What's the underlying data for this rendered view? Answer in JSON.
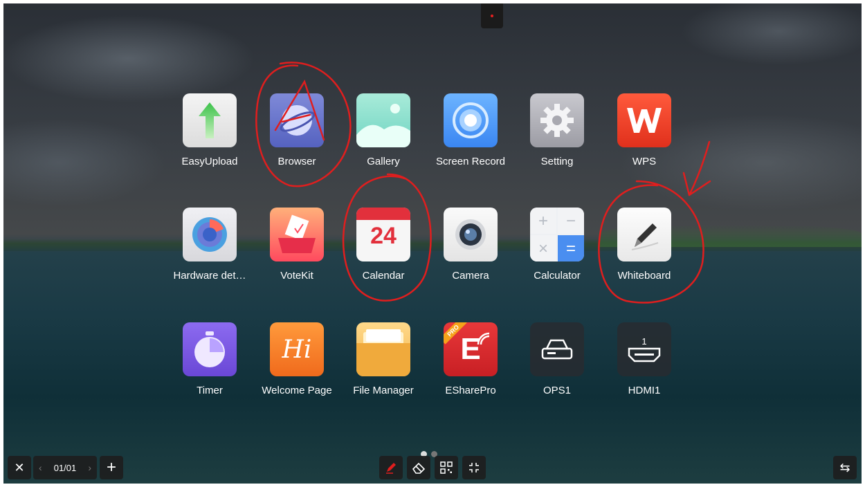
{
  "apps": [
    {
      "id": "easyupload",
      "label": "EasyUpload",
      "icon": "upload-arrow-icon"
    },
    {
      "id": "browser",
      "label": "Browser",
      "icon": "browser-planet-icon"
    },
    {
      "id": "gallery",
      "label": "Gallery",
      "icon": "landscape-icon"
    },
    {
      "id": "screen-record",
      "label": "Screen Record",
      "icon": "record-circle-icon"
    },
    {
      "id": "setting",
      "label": "Setting",
      "icon": "gear-icon"
    },
    {
      "id": "wps",
      "label": "WPS",
      "icon": "wps-logo-icon"
    },
    {
      "id": "hardware",
      "label": "Hardware det…",
      "icon": "radar-icon"
    },
    {
      "id": "votekit",
      "label": "VoteKit",
      "icon": "ballot-box-icon"
    },
    {
      "id": "calendar",
      "label": "Calendar",
      "icon": "calendar-icon",
      "day": "24"
    },
    {
      "id": "camera",
      "label": "Camera",
      "icon": "camera-lens-icon"
    },
    {
      "id": "calculator",
      "label": "Calculator",
      "icon": "calculator-icon",
      "keys": [
        "+",
        "−",
        "×",
        "="
      ]
    },
    {
      "id": "whiteboard",
      "label": "Whiteboard",
      "icon": "pen-icon"
    },
    {
      "id": "timer",
      "label": "Timer",
      "icon": "stopwatch-icon"
    },
    {
      "id": "welcome",
      "label": "Welcome Page",
      "icon": "hi-icon",
      "glyph": "Hi"
    },
    {
      "id": "file-manager",
      "label": "File Manager",
      "icon": "folder-icon"
    },
    {
      "id": "esharepro",
      "label": "ESharePro",
      "icon": "eshare-icon",
      "glyph": "E",
      "badge": "PRO"
    },
    {
      "id": "ops1",
      "label": "OPS1",
      "icon": "ops-device-icon"
    },
    {
      "id": "hdmi1",
      "label": "HDMI1",
      "icon": "hdmi-port-icon",
      "port_number": "1"
    }
  ],
  "bottom_bar": {
    "close_glyph": "✕",
    "page_indicator": "01/01",
    "prev_glyph": "‹",
    "next_glyph": "›",
    "add_glyph": "+",
    "tools": [
      "pen-icon",
      "eraser-icon",
      "qr-code-icon",
      "collapse-icon"
    ],
    "switch_glyph": "⇆"
  },
  "page_dots": {
    "count": 2,
    "active": 0
  },
  "colors": {
    "annotation": "#e01e1e",
    "accent": "#e2303c"
  }
}
